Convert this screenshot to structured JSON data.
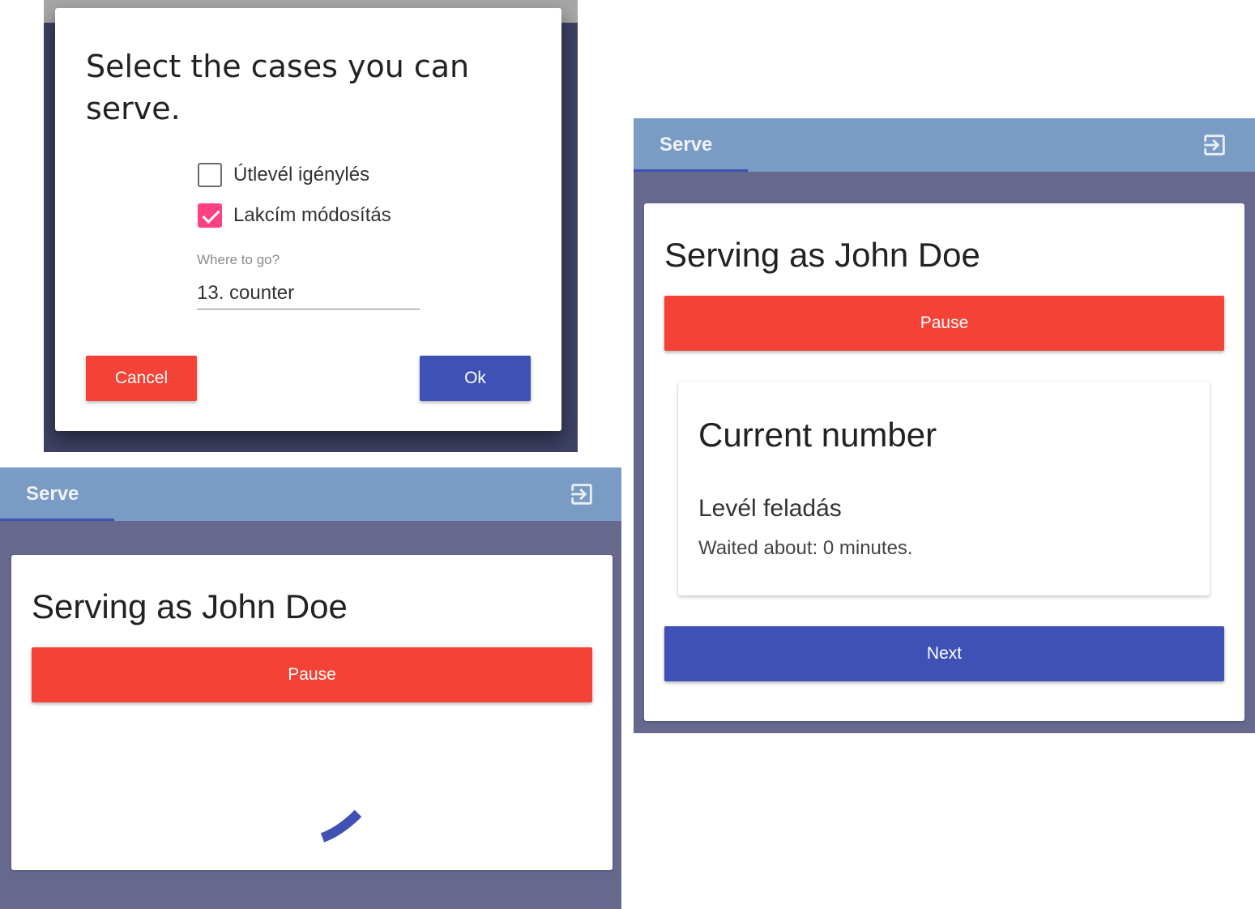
{
  "dialog": {
    "title": "Select the cases you can serve.",
    "checkboxes": [
      {
        "label": "Útlevél igénylés",
        "checked": false
      },
      {
        "label": "Lakcím módosítás",
        "checked": true
      }
    ],
    "where_label": "Where to go?",
    "where_value": "13. counter",
    "cancel_label": "Cancel",
    "ok_label": "Ok"
  },
  "loading_view": {
    "tab_label": "Serve",
    "exit_icon": "exit-to-app-icon",
    "title": "Serving as John Doe",
    "pause_label": "Pause",
    "spinner_icon": "loading-spinner-icon"
  },
  "serving_view": {
    "tab_label": "Serve",
    "exit_icon": "exit-to-app-icon",
    "title": "Serving as John Doe",
    "pause_label": "Pause",
    "current": {
      "heading": "Current number",
      "case_name": "Levél feladás",
      "waited_text": "Waited about: 0 minutes."
    },
    "next_label": "Next"
  },
  "colors": {
    "appbar": "#7a9cc4",
    "background": "#66688e",
    "accent_red": "#f44336",
    "accent_blue": "#3f51b5",
    "checkbox_pink": "#ff4081"
  }
}
